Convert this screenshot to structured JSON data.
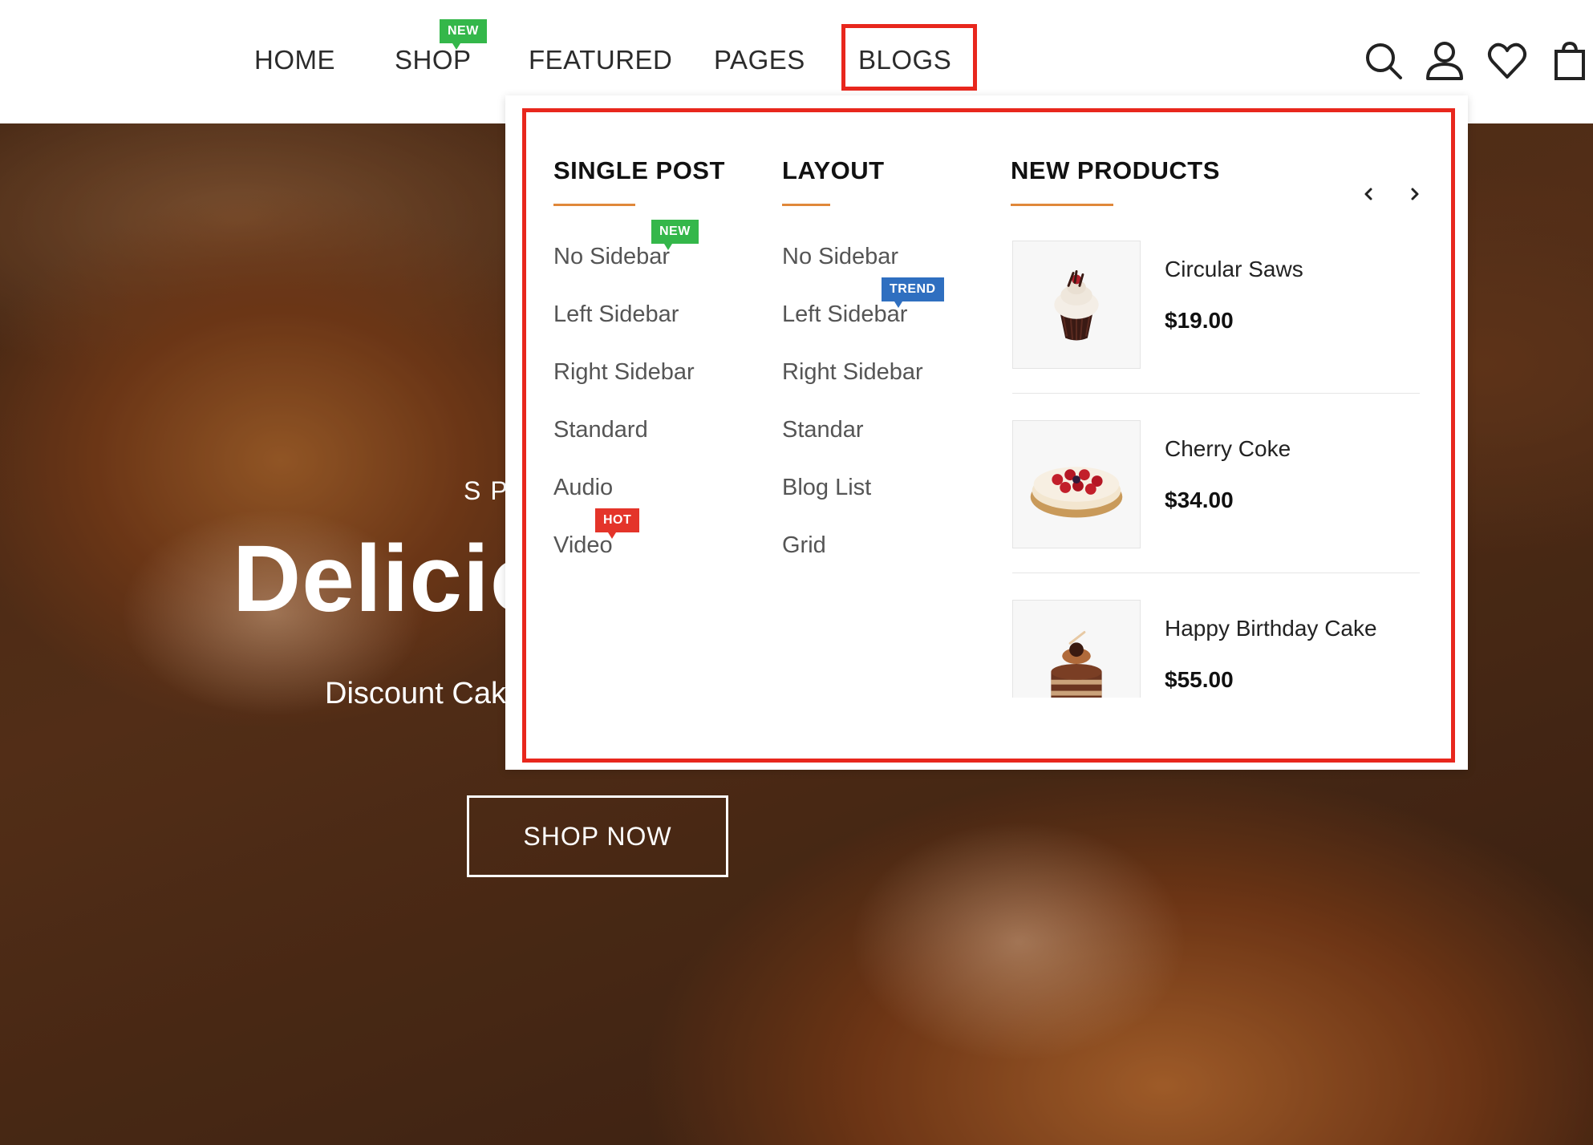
{
  "nav": {
    "items": [
      {
        "label": "HOME"
      },
      {
        "label": "SHOP",
        "badge": "NEW"
      },
      {
        "label": "FEATURED"
      },
      {
        "label": "PAGES"
      },
      {
        "label": "BLOGS"
      }
    ]
  },
  "header_icons": [
    "search-icon",
    "user-icon",
    "heart-icon",
    "shopping-bag-icon"
  ],
  "hero": {
    "subtitle": "SP",
    "title": "Delicio",
    "description": "Discount Cak",
    "button_label": "SHOP NOW"
  },
  "dropdown": {
    "single_post": {
      "title": "SINGLE POST",
      "links": [
        "No Sidebar",
        "Left Sidebar",
        "Right Sidebar",
        "Standard",
        "Audio",
        "Video"
      ],
      "badges": {
        "new": "NEW",
        "hot": "HOT"
      }
    },
    "layout": {
      "title": "LAYOUT",
      "links": [
        "No Sidebar",
        "Left Sidebar",
        "Right Sidebar",
        "Standar",
        "Blog List",
        "Grid"
      ],
      "badges": {
        "trend": "TREND"
      }
    },
    "new_products": {
      "title": "NEW PRODUCTS",
      "items": [
        {
          "name": "Circular Saws",
          "price": "$19.00"
        },
        {
          "name": "Cherry Coke",
          "price": "$34.00"
        },
        {
          "name": "Happy Birthday Cake",
          "price": "$55.00"
        }
      ]
    }
  },
  "colors": {
    "highlight_red": "#e8271d",
    "badge_new": "#34b74a",
    "badge_trend": "#2f6fc0",
    "badge_hot": "#e4342a",
    "accent_underline": "#e0883a"
  }
}
